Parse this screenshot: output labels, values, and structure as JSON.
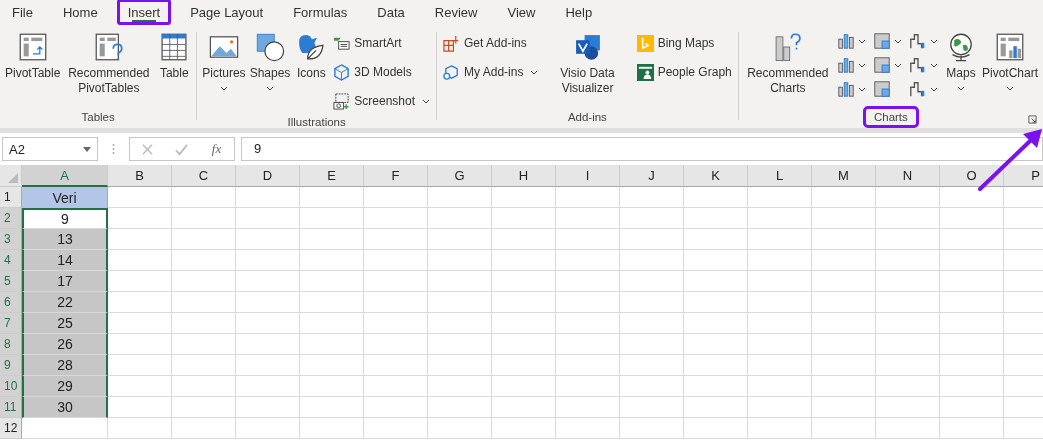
{
  "menu_tabs": [
    {
      "label": "File",
      "selected": false,
      "highlighted": false
    },
    {
      "label": "Home",
      "selected": false,
      "highlighted": false
    },
    {
      "label": "Insert",
      "selected": true,
      "highlighted": true
    },
    {
      "label": "Page Layout",
      "selected": false,
      "highlighted": false
    },
    {
      "label": "Formulas",
      "selected": false,
      "highlighted": false
    },
    {
      "label": "Data",
      "selected": false,
      "highlighted": false
    },
    {
      "label": "Review",
      "selected": false,
      "highlighted": false
    },
    {
      "label": "View",
      "selected": false,
      "highlighted": false
    },
    {
      "label": "Help",
      "selected": false,
      "highlighted": false
    }
  ],
  "ribbon_groups": [
    {
      "label": "Tables",
      "highlighted": false,
      "items": [
        {
          "kind": "large",
          "label": "PivotTable",
          "dropdown": false
        },
        {
          "kind": "large",
          "label": "Recommended PivotTables",
          "dropdown": false
        },
        {
          "kind": "large",
          "label": "Table",
          "dropdown": false
        }
      ]
    },
    {
      "label": "Illustrations",
      "highlighted": false,
      "items": [
        {
          "kind": "large",
          "label": "Pictures",
          "dropdown": true
        },
        {
          "kind": "large",
          "label": "Shapes",
          "dropdown": true
        },
        {
          "kind": "large",
          "label": "Icons",
          "dropdown": false
        },
        {
          "kind": "stack",
          "items": [
            {
              "label": "SmartArt",
              "dropdown": false
            },
            {
              "label": "3D Models",
              "dropdown": false
            },
            {
              "label": "Screenshot",
              "dropdown": true
            }
          ]
        }
      ]
    },
    {
      "label": "Add-ins",
      "highlighted": false,
      "items": [
        {
          "kind": "stack",
          "items": [
            {
              "label": "Get Add-ins",
              "dropdown": false
            },
            {
              "label": "My Add-ins",
              "dropdown": true
            }
          ]
        },
        {
          "kind": "large",
          "label": "Visio Data Visualizer",
          "dropdown": false
        },
        {
          "kind": "stack",
          "items": [
            {
              "label": "Bing Maps",
              "dropdown": false
            },
            {
              "label": "People Graph",
              "dropdown": false
            }
          ]
        }
      ]
    },
    {
      "label": "Charts",
      "highlighted": true,
      "launcher": true,
      "items": [
        {
          "kind": "large",
          "label": "Recommended Charts",
          "dropdown": false
        },
        {
          "kind": "chart-grid",
          "items": [
            {
              "dropdown": true
            },
            {
              "dropdown": true
            },
            {
              "dropdown": true
            },
            {
              "dropdown": true
            },
            {
              "dropdown": true
            },
            {
              "dropdown": true
            },
            {
              "dropdown": true
            },
            {
              "dropdown": false
            },
            {
              "dropdown": true
            }
          ]
        },
        {
          "kind": "large",
          "label": "Maps",
          "dropdown": true
        },
        {
          "kind": "large",
          "label": "PivotChart",
          "dropdown": true
        }
      ]
    }
  ],
  "formula_bar": {
    "name_box": "A2",
    "fx_label": "fx",
    "value": "9"
  },
  "columns": [
    "A",
    "B",
    "C",
    "D",
    "E",
    "F",
    "G",
    "H",
    "I",
    "J",
    "K",
    "L",
    "M",
    "N",
    "O",
    "P"
  ],
  "rows": [
    {
      "number": "1",
      "a": "Veri",
      "kind": "header"
    },
    {
      "number": "2",
      "a": "9",
      "kind": "active"
    },
    {
      "number": "3",
      "a": "13",
      "kind": "selected"
    },
    {
      "number": "4",
      "a": "14",
      "kind": "selected"
    },
    {
      "number": "5",
      "a": "17",
      "kind": "selected"
    },
    {
      "number": "6",
      "a": "22",
      "kind": "selected"
    },
    {
      "number": "7",
      "a": "25",
      "kind": "selected"
    },
    {
      "number": "8",
      "a": "26",
      "kind": "selected"
    },
    {
      "number": "9",
      "a": "28",
      "kind": "selected"
    },
    {
      "number": "10",
      "a": "29",
      "kind": "selected"
    },
    {
      "number": "11",
      "a": "30",
      "kind": "selected"
    },
    {
      "number": "12",
      "kind": "plain"
    }
  ],
  "pointer_arrow": true
}
